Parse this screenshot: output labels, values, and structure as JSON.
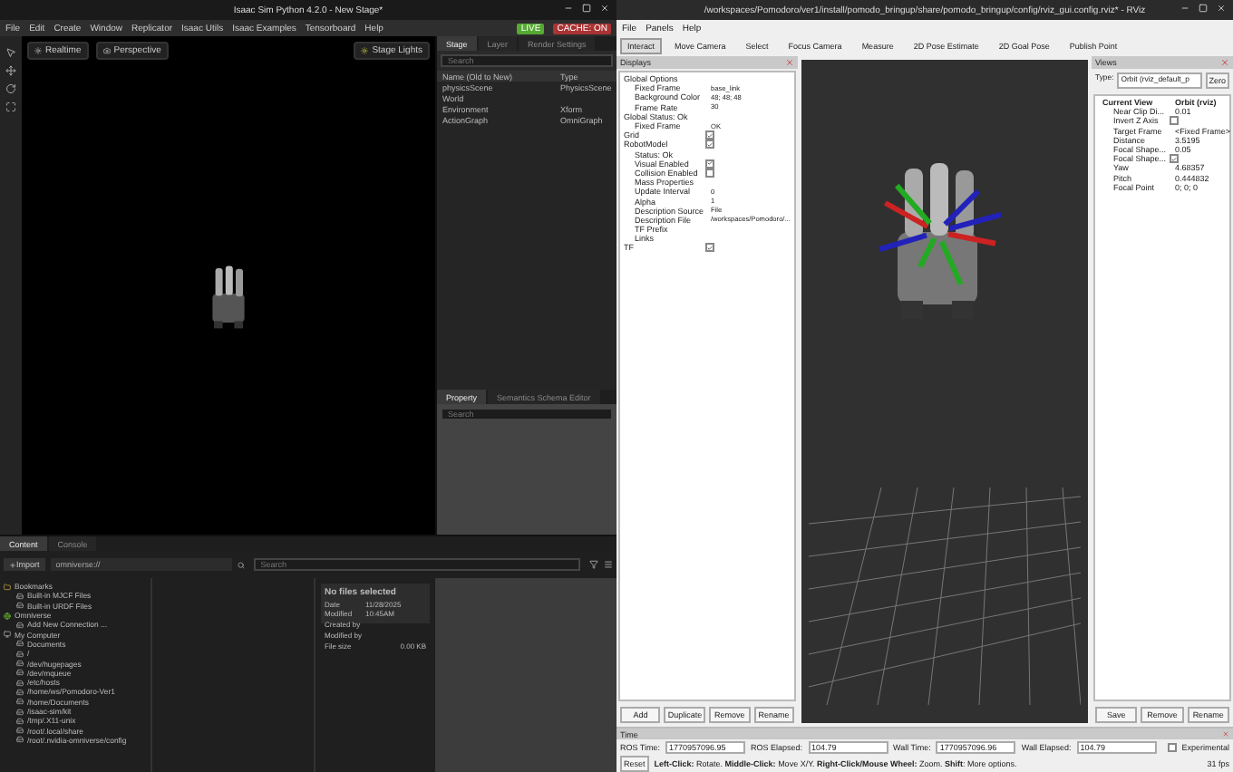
{
  "isaac": {
    "title": "Isaac Sim Python 4.2.0 - New Stage*",
    "menu": [
      "File",
      "Edit",
      "Create",
      "Window",
      "Replicator",
      "Isaac Utils",
      "Isaac Examples",
      "Tensorboard",
      "Help"
    ],
    "live": "LIVE",
    "cache": "CACHE: ON",
    "viewport": {
      "render": "Realtime",
      "camera": "Perspective",
      "lights": "Stage Lights"
    },
    "stage": {
      "tabs": [
        {
          "label": "Stage",
          "selected": true
        },
        {
          "label": "Layer",
          "selected": false
        },
        {
          "label": "Render Settings",
          "selected": false
        }
      ],
      "search_placeholder": "Search",
      "columns": [
        "Name (Old to New)",
        "Type"
      ],
      "rows": [
        {
          "name": "physicsScene",
          "type": "PhysicsScene"
        },
        {
          "name": "World",
          "type": ""
        },
        {
          "name": "Environment",
          "type": "Xform"
        },
        {
          "name": "ActionGraph",
          "type": "OmniGraph"
        }
      ]
    },
    "property": {
      "tabs": [
        {
          "label": "Property",
          "selected": true
        },
        {
          "label": "Semantics Schema Editor",
          "selected": false
        }
      ],
      "search_placeholder": "Search"
    },
    "content": {
      "tabs": [
        {
          "label": "Content",
          "selected": true
        },
        {
          "label": "Console",
          "selected": false
        }
      ],
      "import": "Import",
      "path": "omniverse://",
      "search_placeholder": "Search",
      "tree": [
        {
          "label": "Bookmarks",
          "children": [
            {
              "label": "Built-in MJCF Files"
            },
            {
              "label": "Built-in URDF Files"
            }
          ]
        },
        {
          "label": "Omniverse",
          "children": [
            {
              "label": "Add New Connection ..."
            }
          ]
        },
        {
          "label": "My Computer",
          "children": [
            {
              "label": "Documents"
            },
            {
              "label": "/"
            },
            {
              "label": "/dev/hugepages"
            },
            {
              "label": "/dev/mqueue"
            },
            {
              "label": "/etc/hosts"
            },
            {
              "label": "/home/ws/Pomodoro-Ver1"
            },
            {
              "label": "/home/Documents"
            },
            {
              "label": "/isaac-sim/kit"
            },
            {
              "label": "/tmp/.X11-unix"
            },
            {
              "label": "/root/.local/share"
            },
            {
              "label": "/root/.nvidia-omniverse/config"
            }
          ]
        }
      ],
      "info": {
        "title": "No files selected",
        "rows": [
          {
            "label": "Date Modified",
            "value": "11/28/2025 10:45AM"
          },
          {
            "label": "Created by",
            "value": ""
          },
          {
            "label": "Modified by",
            "value": ""
          },
          {
            "label": "File size",
            "value": "0.00 KB"
          }
        ]
      }
    }
  },
  "rviz": {
    "title": "/workspaces/Pomodoro/ver1/install/pomodo_bringup/share/pomodo_bringup/config/rviz_gui.config.rviz* - RViz",
    "menu": [
      "File",
      "Panels",
      "Help"
    ],
    "toolbar": [
      {
        "label": "Interact",
        "selected": true
      },
      {
        "label": "Move Camera",
        "selected": false
      },
      {
        "label": "Select",
        "selected": false
      },
      {
        "label": "Focus Camera",
        "selected": false
      },
      {
        "label": "Measure",
        "selected": false
      },
      {
        "label": "2D Pose Estimate",
        "selected": false
      },
      {
        "label": "2D Goal Pose",
        "selected": false
      },
      {
        "label": "Publish Point",
        "selected": false
      }
    ],
    "displays": {
      "title": "Displays",
      "items": [
        {
          "label": "Global Options",
          "children": [
            {
              "label": "Fixed Frame",
              "value": "base_link"
            },
            {
              "label": "Background Color",
              "value": "48; 48; 48"
            },
            {
              "label": "Frame Rate",
              "value": "30"
            }
          ]
        },
        {
          "label": "Global Status: Ok",
          "children": [
            {
              "label": "Fixed Frame",
              "value": "OK"
            }
          ]
        },
        {
          "label": "Grid",
          "checked": true
        },
        {
          "label": "RobotModel",
          "checked": true,
          "children": [
            {
              "label": "Status: Ok"
            },
            {
              "label": "Visual Enabled",
              "checked": true
            },
            {
              "label": "Collision Enabled",
              "checked": false
            },
            {
              "label": "Mass Properties"
            },
            {
              "label": "Update Interval",
              "value": "0"
            },
            {
              "label": "Alpha",
              "value": "1"
            },
            {
              "label": "Description Source",
              "value": "File"
            },
            {
              "label": "Description File",
              "value": "/workspaces/Pomodoro/..."
            },
            {
              "label": "TF Prefix"
            },
            {
              "label": "Links"
            }
          ]
        },
        {
          "label": "TF",
          "checked": true
        }
      ],
      "buttons": [
        "Add",
        "Duplicate",
        "Remove",
        "Rename"
      ]
    },
    "views": {
      "title": "Views",
      "type_label": "Type:",
      "type_value": "Orbit (rviz_default_p",
      "zero": "Zero",
      "current": {
        "label": "Current View",
        "value": "Orbit (rviz)"
      },
      "rows": [
        {
          "label": "Near Clip Di...",
          "value": "0.01"
        },
        {
          "label": "Invert Z Axis",
          "checked": false
        },
        {
          "label": "Target Frame",
          "value": "<Fixed Frame>"
        },
        {
          "label": "Distance",
          "value": "3.5195"
        },
        {
          "label": "Focal Shape...",
          "value": "0.05"
        },
        {
          "label": "Focal Shape...",
          "checked": true
        },
        {
          "label": "Yaw",
          "value": "4.68357"
        },
        {
          "label": "Pitch",
          "value": "0.444832"
        },
        {
          "label": "Focal Point",
          "value": "0; 0; 0"
        }
      ],
      "buttons": [
        "Save",
        "Remove",
        "Rename"
      ]
    },
    "time": {
      "title": "Time",
      "fields": [
        {
          "label": "ROS Time:",
          "value": "1770957096.95"
        },
        {
          "label": "ROS Elapsed:",
          "value": "104.79"
        },
        {
          "label": "Wall Time:",
          "value": "1770957096.96"
        },
        {
          "label": "Wall Elapsed:",
          "value": "104.79"
        }
      ],
      "experimental": "Experimental",
      "experimental_checked": false,
      "fps": "31 fps"
    },
    "status": {
      "reset": "Reset",
      "hint": "**Left-Click:** Rotate. **Middle-Click:** Move X/Y. **Right-Click/Mouse Wheel:** Zoom. **Shift**: More options."
    }
  }
}
